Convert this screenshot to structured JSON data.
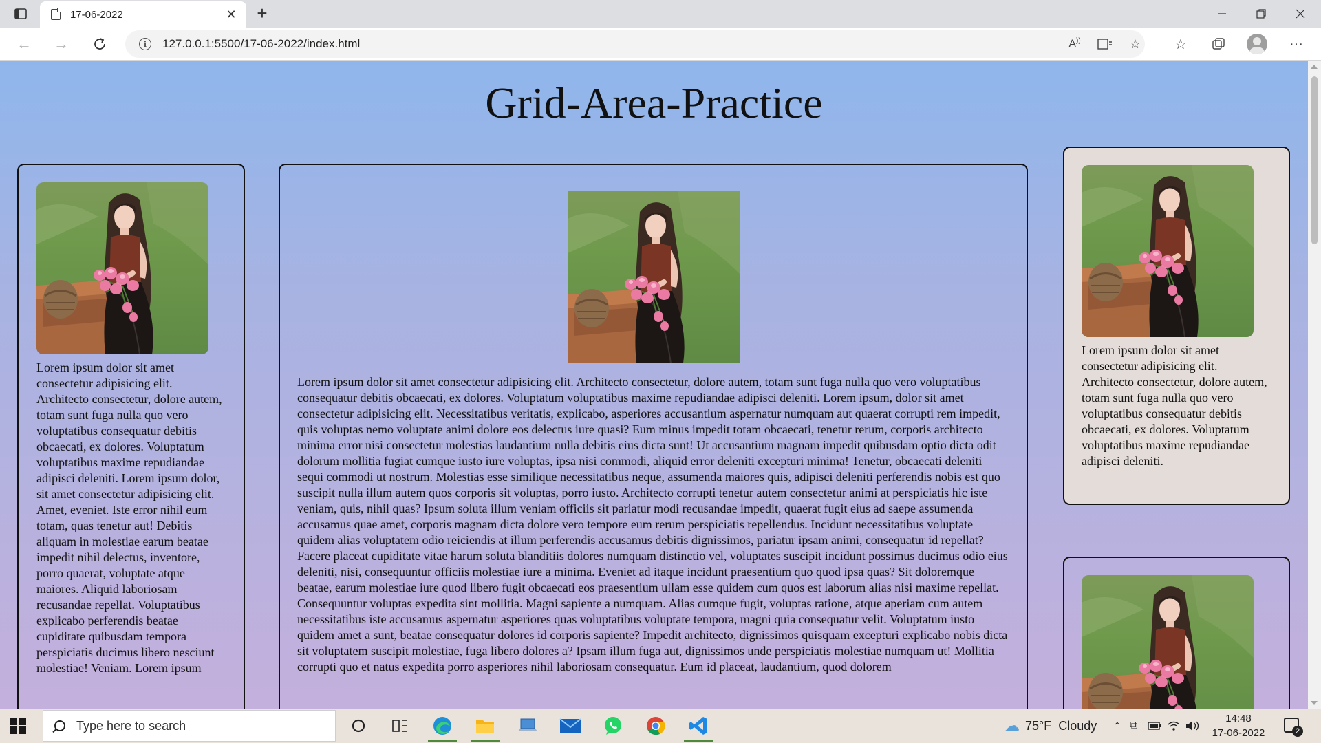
{
  "browser": {
    "tab_title": "17-06-2022",
    "url": "127.0.0.1:5500/17-06-2022/index.html"
  },
  "page": {
    "heading": "Grid-Area-Practice",
    "left_text": "Lorem ipsum dolor sit amet consectetur adipisicing elit. Architecto consectetur, dolore autem, totam sunt fuga nulla quo vero voluptatibus consequatur debitis obcaecati, ex dolores. Voluptatum voluptatibus maxime repudiandae adipisci deleniti. Lorem ipsum dolor, sit amet consectetur adipisicing elit. Amet, eveniet. Iste error nihil eum totam, quas tenetur aut! Debitis aliquam in molestiae earum beatae impedit nihil delectus, inventore, porro quaerat, voluptate atque maiores. Aliquid laboriosam recusandae repellat. Voluptatibus explicabo perferendis beatae cupiditate quibusdam tempora perspiciatis ducimus libero nesciunt molestiae! Veniam. Lorem ipsum",
    "main_text": "Lorem ipsum dolor sit amet consectetur adipisicing elit. Architecto consectetur, dolore autem, totam sunt fuga nulla quo vero voluptatibus consequatur debitis obcaecati, ex dolores. Voluptatum voluptatibus maxime repudiandae adipisci deleniti. Lorem ipsum, dolor sit amet consectetur adipisicing elit. Necessitatibus veritatis, explicabo, asperiores accusantium aspernatur numquam aut quaerat corrupti rem impedit, quis voluptas nemo voluptate animi dolore eos delectus iure quasi? Eum minus impedit totam obcaecati, tenetur rerum, corporis architecto minima error nisi consectetur molestias laudantium nulla debitis eius dicta sunt! Ut accusantium magnam impedit quibusdam optio dicta odit dolorum mollitia fugiat cumque iusto iure voluptas, ipsa nisi commodi, aliquid error deleniti excepturi minima! Tenetur, obcaecati deleniti sequi commodi ut nostrum. Molestias esse similique necessitatibus neque, assumenda maiores quis, adipisci deleniti perferendis nobis est quo suscipit nulla illum autem quos corporis sit voluptas, porro iusto. Architecto corrupti tenetur autem consectetur animi at perspiciatis hic iste veniam, quis, nihil quas? Ipsum soluta illum veniam officiis sit pariatur modi recusandae impedit, quaerat fugit eius ad saepe assumenda accusamus quae amet, corporis magnam dicta dolore vero tempore eum rerum perspiciatis repellendus. Incidunt necessitatibus voluptate quidem alias voluptatem odio reiciendis at illum perferendis accusamus debitis dignissimos, pariatur ipsam animi, consequatur id repellat? Facere placeat cupiditate vitae harum soluta blanditiis dolores numquam distinctio vel, voluptates suscipit incidunt possimus ducimus odio eius deleniti, nisi, consequuntur officiis molestiae iure a minima. Eveniet ad itaque incidunt praesentium quo quod ipsa quas? Sit doloremque beatae, earum molestiae iure quod libero fugit obcaecati eos praesentium ullam esse quidem cum quos est laborum alias nisi maxime repellat. Consequuntur voluptas expedita sint mollitia. Magni sapiente a numquam. Alias cumque fugit, voluptas ratione, atque aperiam cum autem necessitatibus iste accusamus aspernatur asperiores quas voluptatibus voluptate tempora, magni quia consequatur velit. Voluptatum iusto quidem amet a sunt, beatae consequatur dolores id corporis sapiente? Impedit architecto, dignissimos quisquam excepturi explicabo nobis dicta sit voluptatem suscipit molestiae, fuga libero dolores a? Ipsam illum fuga aut, dignissimos unde perspiciatis molestiae numquam ut! Mollitia corrupti quo et natus expedita porro asperiores nihil laboriosam consequatur. Eum id placeat, laudantium, quod dolorem",
    "right_text": "Lorem ipsum dolor sit amet consectetur adipisicing elit. Architecto consectetur, dolore autem, totam sunt fuga nulla quo vero voluptatibus consequatur debitis obcaecati, ex dolores. Voluptatum voluptatibus maxime repudiandae adipisci deleniti."
  },
  "taskbar": {
    "search_placeholder": "Type here to search",
    "weather": "75°F  Cloudy",
    "time": "14:48",
    "date": "17-06-2022",
    "notification_count": "2"
  },
  "icons": [
    "tab-actions-icon",
    "page-icon",
    "close-icon",
    "plus-icon",
    "minimize-icon",
    "maximize-icon",
    "back-icon",
    "forward-icon",
    "refresh-icon",
    "info-icon",
    "read-aloud-icon",
    "immersive-reader-icon",
    "add-favorite-icon",
    "favorites-icon",
    "collections-icon",
    "profile-icon",
    "more-icon",
    "windows-start-icon",
    "search-icon",
    "cortana-icon",
    "task-view-icon",
    "edge-icon",
    "file-explorer-icon",
    "laptop-app-icon",
    "mail-icon",
    "whatsapp-icon",
    "chrome-icon",
    "vscode-icon",
    "weather-cloud-icon",
    "notifications-icon"
  ]
}
